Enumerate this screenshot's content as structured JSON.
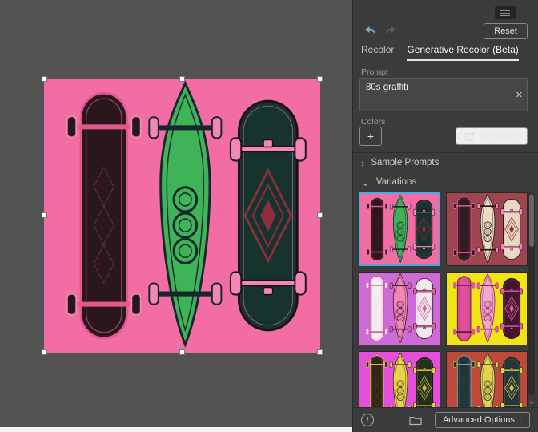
{
  "window": {
    "canvas_bg": "#535353",
    "panel_bg": "#3b3b3b"
  },
  "panel": {
    "reset_label": "Reset",
    "tabs": [
      {
        "label": "Recolor",
        "active": false
      },
      {
        "label": "Generative Recolor (Beta)",
        "active": true
      }
    ],
    "prompt": {
      "label": "Prompt",
      "value": "80s graffiti"
    },
    "colors_label": "Colors",
    "generate_label": "Generate",
    "sample_prompts_label": "Sample Prompts",
    "variations_label": "Variations",
    "advanced_options_label": "Advanced Options...",
    "selection_color": "#57a3e8",
    "glyphs": {
      "close": "✕",
      "plus": "+",
      "chevron_right": "›",
      "chevron_down": "⌄",
      "info": "i"
    }
  },
  "artwork": {
    "palette": {
      "bg": "#F16DA3",
      "b1": "#2A171C",
      "b1t": "#E3598F",
      "b2": "#3FB357",
      "b2t": "#17262D",
      "b3": "#17332D",
      "b3t": "#8C2E3C",
      "wh": "#F087B4"
    }
  },
  "variations": [
    {
      "selected": true,
      "palette": {
        "bg": "#F16DA3",
        "b1": "#2A171C",
        "b1t": "#E3598F",
        "b2": "#3FB357",
        "b2t": "#17262D",
        "b3": "#17332D",
        "b3t": "#8C2E3C",
        "wh": "#F087B4"
      }
    },
    {
      "selected": false,
      "palette": {
        "bg": "#9E4550",
        "b1": "#311B20",
        "b1t": "#E3598F",
        "b2": "#EADCC3",
        "b2t": "#241219",
        "b3": "#E8D7C2",
        "b3t": "#9A2E3C",
        "wh": "#F087B4"
      }
    },
    {
      "selected": false,
      "palette": {
        "bg": "#CF6BD6",
        "b1": "#F2EEF0",
        "b1t": "#C94F93",
        "b2": "#F087B4",
        "b2t": "#3A1F33",
        "b3": "#EFE9EC",
        "b3t": "#D9579E",
        "wh": "#E560A8"
      }
    },
    {
      "selected": false,
      "palette": {
        "bg": "#F2E317",
        "b1": "#E1519E",
        "b1t": "#47102E",
        "b2": "#F0A9CD",
        "b2t": "#8C1F5E",
        "b3": "#451430",
        "b3t": "#E560A8",
        "wh": "#E560A8"
      }
    },
    {
      "selected": false,
      "palette": {
        "bg": "#E34FD6",
        "b1": "#2F2518",
        "b1t": "#E8D44A",
        "b2": "#E8D44A",
        "b2t": "#3A2F10",
        "b3": "#21301A",
        "b3t": "#C9B43A",
        "wh": "#E8D44A"
      }
    },
    {
      "selected": false,
      "palette": {
        "bg": "#BF4A3C",
        "b1": "#20343A",
        "b1t": "#7FB3A8",
        "b2": "#E3D24E",
        "b2t": "#243036",
        "b3": "#22363C",
        "b3t": "#D9C04A",
        "wh": "#E3D24E"
      }
    }
  ]
}
